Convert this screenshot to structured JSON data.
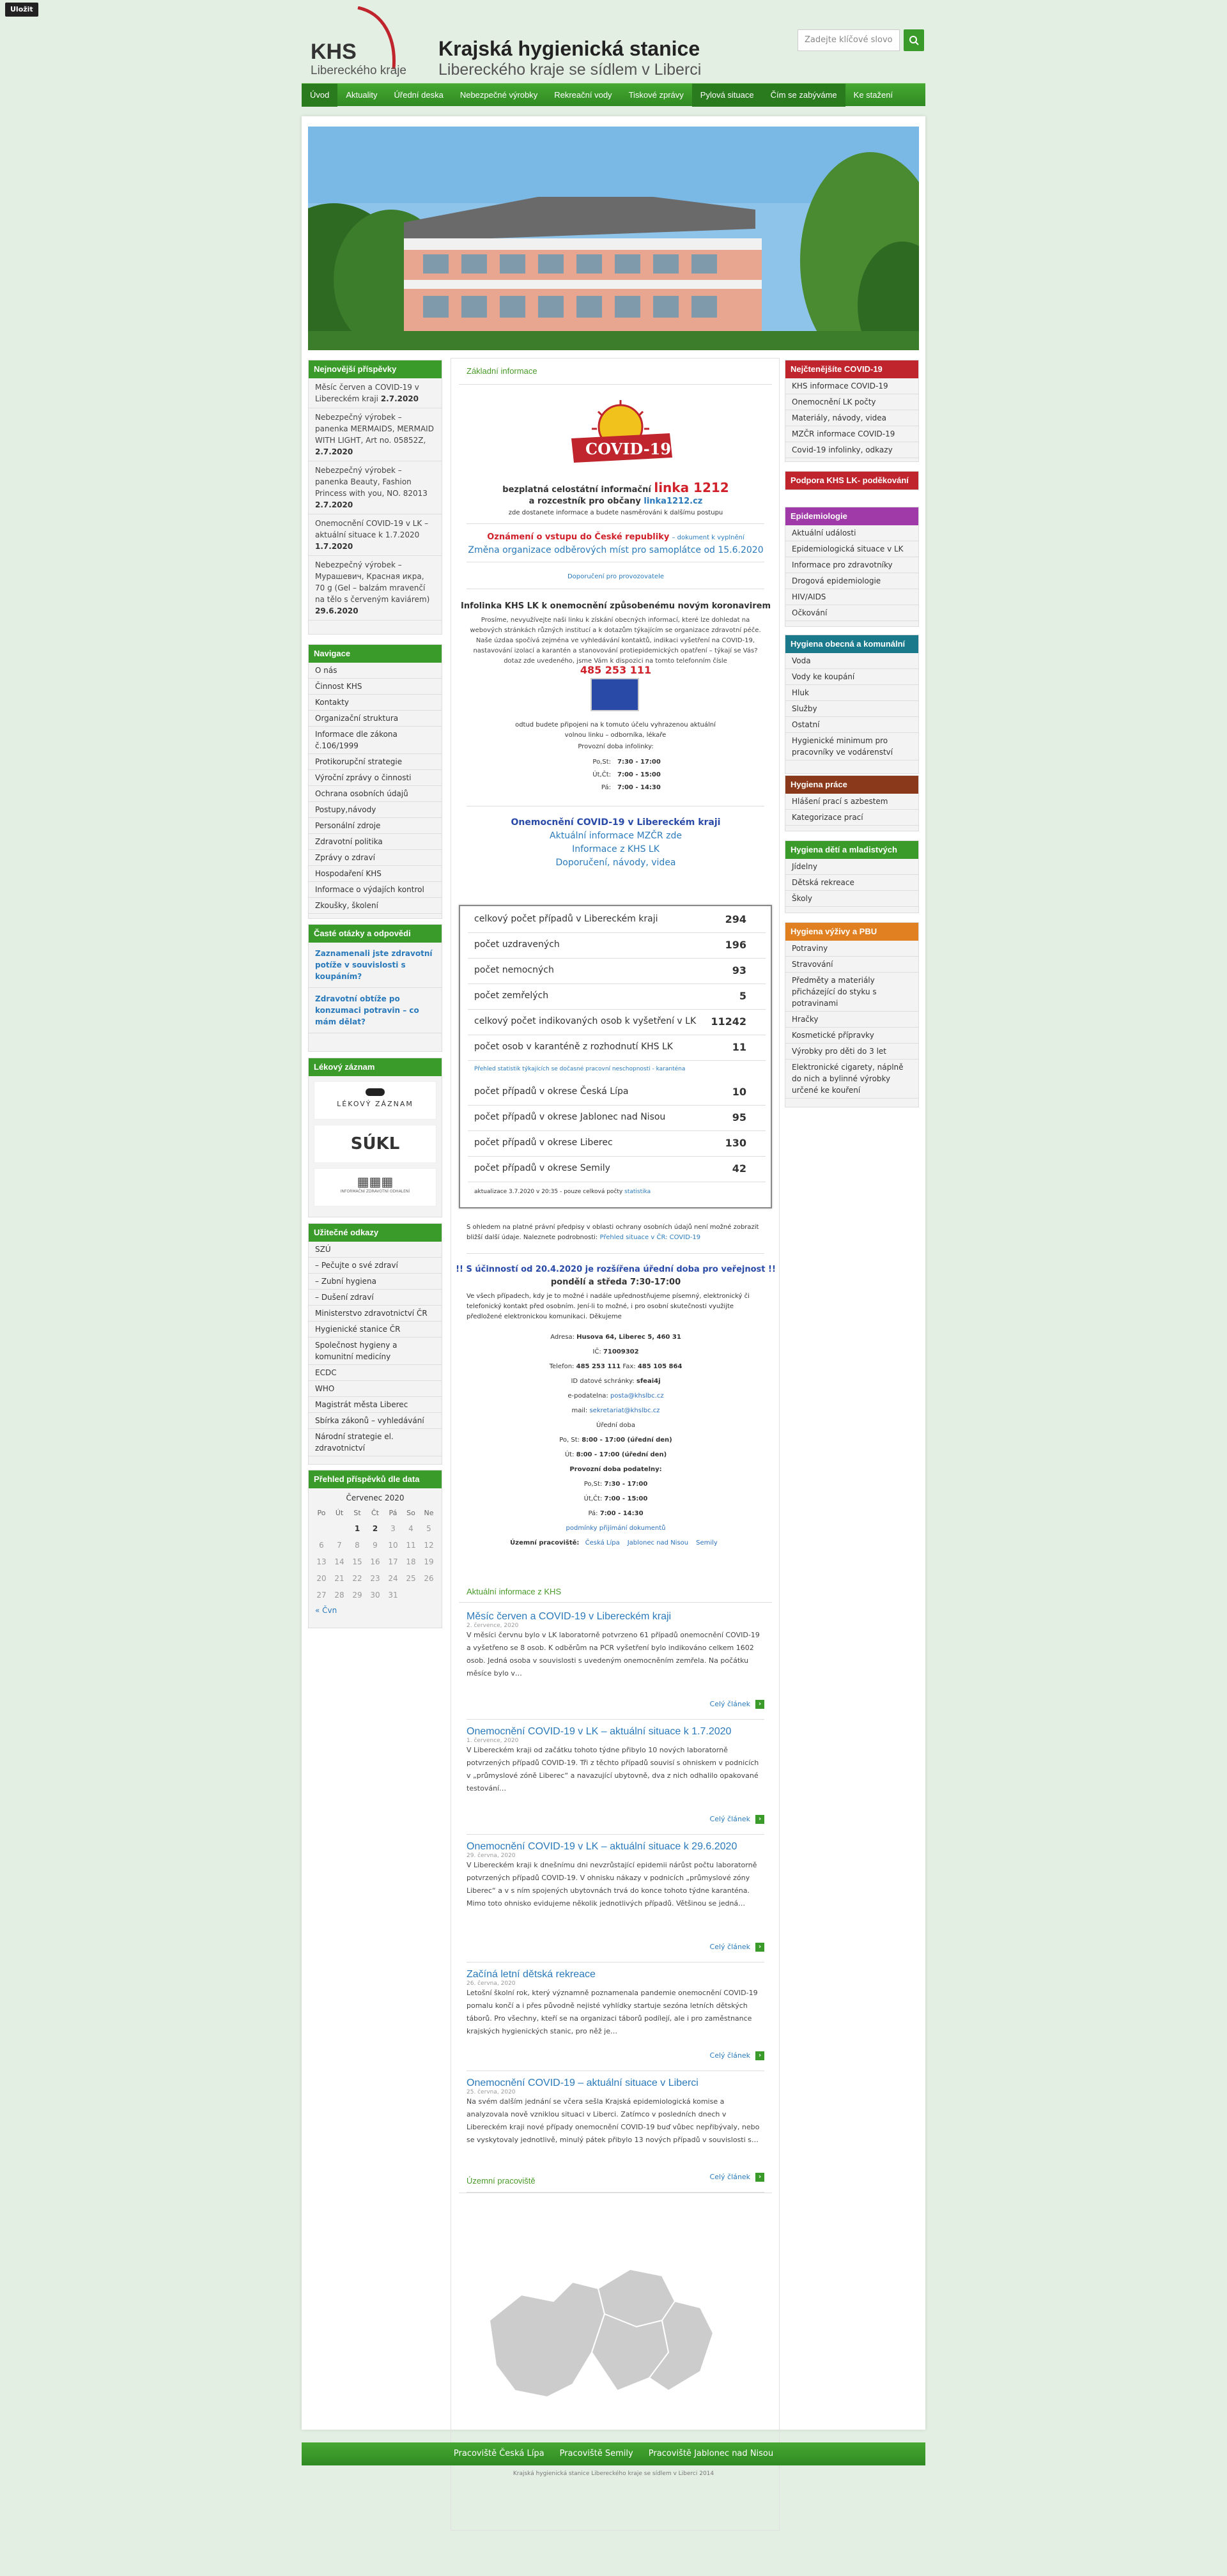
{
  "tag": "Uložit",
  "header": {
    "logo_big": "KHS",
    "logo_sub": "Libereckého kraje",
    "title": "Krajská hygienická stanice",
    "subtitle": "Libereckého kraje se sídlem v Liberci",
    "search_placeholder": "Zadejte klíčové slovo"
  },
  "nav": [
    "Úvod",
    "Aktuality",
    "Úřední deska",
    "Nebezpečné výrobky",
    "Rekreační vody",
    "Tiskové zprávy",
    "Pylová situace",
    "Čím se zabýváme",
    "Ke stažení"
  ],
  "left": {
    "latest_title": "Nejnovější příspěvky",
    "latest": [
      {
        "t": "Měsíc červen a COVID-19 v Libereckém kraji",
        "d": "2.7.2020"
      },
      {
        "t": "Nebezpečný výrobek – panenka MERMAIDS, MERMAID WITH LIGHT, Art no. 05852Z,",
        "d": "2.7.2020"
      },
      {
        "t": "Nebezpečný výrobek – panenka Beauty, Fashion Princess with you, NO. 82013",
        "d": "2.7.2020"
      },
      {
        "t": "Onemocnění COVID-19 v LK – aktuální situace k 1.7.2020",
        "d": "1.7.2020"
      },
      {
        "t": "Nebezpečný výrobek – Мурашевич, Красная икра, 70 g (Gel – balzám mravenčí na tělo s červeným kaviárem)",
        "d": "29.6.2020"
      }
    ],
    "nav_title": "Navigace",
    "nav_items": [
      "O nás",
      "Činnost KHS",
      "Kontakty",
      "Organizační struktura",
      "Informace dle zákona č.106/1999",
      "Protikorupční strategie",
      "Výroční zprávy o činnosti",
      "Ochrana osobních údajů",
      "Postupy,návody",
      "Personální zdroje",
      "Zdravotní politika",
      "Zprávy o zdraví",
      "Hospodaření KHS",
      "Informace o výdajích kontrol",
      "Zkoušky, školení"
    ],
    "faq_title": "Časté otázky a odpovědi",
    "faq": [
      "Zaznamenali jste zdravotní potíže v souvislosti s koupáním?",
      "Zdravotní obtíže po konzumaci potravin – co mám dělat?"
    ],
    "drug_title": "Lékový záznam",
    "drug_logos": [
      "LÉKOVÝ ZÁZNAM",
      "SÚKL",
      "INFORMAČNÍ ZDRAVOTNÍ ODHALENÍ"
    ],
    "links_title": "Užitečné odkazy",
    "links": [
      "SZÚ",
      "– Pečujte o své zdraví",
      "– Zubní hygiena",
      "– Dušení zdraví",
      "Ministerstvo zdravotnictví ČR",
      "Hygienické stanice ČR",
      "Společnost hygieny a komunitní medicíny",
      "ECDC",
      "WHO",
      "Magistrát města Liberec",
      "Sbírka zákonů – vyhledávání",
      "Národní strategie el. zdravotnictví"
    ],
    "cal_title": "Přehled příspěvků dle data",
    "cal_month": "Červenec 2020",
    "cal_days": [
      "Po",
      "Út",
      "St",
      "Čt",
      "Pá",
      "So",
      "Ne"
    ],
    "cal_rows": [
      [
        "",
        "",
        "1",
        "2",
        "3",
        "4",
        "5"
      ],
      [
        "6",
        "7",
        "8",
        "9",
        "10",
        "11",
        "12"
      ],
      [
        "13",
        "14",
        "15",
        "16",
        "17",
        "18",
        "19"
      ],
      [
        "20",
        "21",
        "22",
        "23",
        "24",
        "25",
        "26"
      ],
      [
        "27",
        "28",
        "29",
        "30",
        "31",
        "",
        ""
      ]
    ],
    "cal_prev": "« Čvn"
  },
  "right": {
    "covid_title": "Nejčtenějšíte COVID-19",
    "covid": [
      "KHS informace COVID-19",
      "Onemocnění LK počty",
      "Materiály, návody, videa",
      "MZČR informace COVID-19",
      "Covid-19 infolinky, odkazy"
    ],
    "support": "Podpora KHS LK- poděkování",
    "epi_title": "Epidemiologie",
    "epi": [
      "Aktuální události",
      "Epidemiologická situace v LK",
      "Informace pro zdravotníky",
      "Drogová epidemiologie",
      "HIV/AIDS",
      "Očkování"
    ],
    "hyg_title": "Hygiena obecná a komunální",
    "hyg": [
      "Voda",
      "Vody ke koupání",
      "Hluk",
      "Služby",
      "Ostatní",
      "Hygienické minimum pro pracovníky ve vodárenství"
    ],
    "work_title": "Hygiena práce",
    "work": [
      "Hlášení prací s azbestem",
      "Kategorizace prací"
    ],
    "kids_title": "Hygiena dětí a mladistvých",
    "kids": [
      "Jídelny",
      "Dětská rekreace",
      "Školy"
    ],
    "food_title": "Hygiena výživy a PBU",
    "food": [
      "Potraviny",
      "Stravování",
      "Předměty a materiály přicházející do styku s potravinami",
      "Hračky",
      "Kosmetické přípravky",
      "Výrobky pro děti do 3 let",
      "Elektronické cigarety, náplně do nich a bylinné výrobky určené ke kouření"
    ]
  },
  "main": {
    "basic_title": "Základní informace",
    "covid_logo": "COVID-19",
    "hotline_a": "bezplatná celostátní informační",
    "hotline_num": "linka 1212",
    "hotline_b": "a rozcestník pro občany",
    "hotline_link": "linka1212.cz",
    "hotline_c": "zde dostanete informace a budete nasměrováni k dalšímu postupu",
    "notice_red": "Oznámení o vstupu do České republiky",
    "notice_link": "– dokument k vyplnění",
    "notice_change": "Změna organizace odběrových míst pro samoplátce od 15.6.2020",
    "notice_small": "Doporučení pro provozovatele",
    "info_title": "Infolinka KHS LK k onemocnění způsobenému novým koronavirem",
    "info_text": "Prosíme, nevyužívejte naši linku k získání obecných informací, které lze dohledat na webových stránkách různých institucí a k dotazům týkajícím se organizace zdravotní péče. Naše úzdaa spočívá zejména ve vyhledávání kontaktů, indikaci vyšetření na COVID-19, nastavování izolací a karantén a stanovování protiepidemických opatření – týkají se Vás? dotaz zde uvedeného, jsme Vám k dispozici na tomto telefonním čísle",
    "info_phone": "485 253 111",
    "info_after": "odtud budete připojeni na k tomuto účelu vyhrazenou aktuální volnou linku – odborníka, lékaře",
    "hours_title": "Provozní doba infolinky:",
    "hours": [
      {
        "d": "Po,St:",
        "h": "7:30 - 17:00"
      },
      {
        "d": "Út,Čt:",
        "h": "7:00 - 15:00"
      },
      {
        "d": "Pá:",
        "h": "7:00 - 14:30"
      }
    ],
    "links_block": [
      "Onemocnění COVID-19 v Libereckém kraji",
      "Aktuální informace MZČR zde",
      "Informace z KHS LK",
      "Doporučení, návody, videa"
    ],
    "stats": [
      {
        "l": "celkový počet případů v Libereckém kraji",
        "v": "294"
      },
      {
        "l": "počet uzdravených",
        "v": "196"
      },
      {
        "l": "počet nemocných",
        "v": "93"
      },
      {
        "l": "počet zemřelých",
        "v": "5"
      },
      {
        "l": "celkový počet indikovaných osob k vyšetření v LK",
        "v": "11242"
      },
      {
        "l": "počet osob v karanténě z rozhodnutí KHS LK",
        "v": "11"
      }
    ],
    "stats_note": "Přehled statistik týkajících se dočasné pracovní neschopnosti - karanténa",
    "stats2": [
      {
        "l": "počet případů v okrese Česká Lípa",
        "v": "10"
      },
      {
        "l": "počet případů v okrese Jablonec nad Nisou",
        "v": "95"
      },
      {
        "l": "počet případů v okrese Liberec",
        "v": "130"
      },
      {
        "l": "počet případů v okrese Semily",
        "v": "42"
      }
    ],
    "stats_updated": "aktualizace 3.7.2020 v 20:35 - pouze celková počty",
    "stats_link": "statistika",
    "legal": "S ohledem na platné právní předpisy v oblasti ochrany osobních údajů není možné zobrazit bližší další údaje. Naleznete podrobnosti:",
    "legal_link": "Přehled situace v ČR: COVID-19",
    "office_title": "!! S účinností od 20.4.2020 je rozšířena úřední doba pro veřejnost !!",
    "office_sub": "pondělí a středa 7:30-17:00",
    "office_text": "Ve všech případech, kdy je to možné i nadále upřednostňujeme písemný, elektronický či telefonický kontakt před osobním. Jení-li to možné, i pro osobní skutečnosti využijte předložené elektronickou komunikaci. Děkujeme",
    "addr_l": "Adresa:",
    "addr": "Husova 64, Liberec 5, 460 31",
    "ic_l": "IČ:",
    "ic": "71009302",
    "tel_l": "Telefon:",
    "tel": "485 253 111",
    "fax_l": "Fax:",
    "fax": "485 105 864",
    "ds_l": "ID datové schránky:",
    "ds": "sfeai4j",
    "epod_l": "e-podatelna:",
    "epod": "posta@khslbc.cz",
    "mail_l": "mail:",
    "mail": "sekretariat@khslbc.cz",
    "uredni": "Úřední doba",
    "uh": [
      {
        "d": "Po, St:",
        "h": "8:00 - 17:00 (úřední den)"
      },
      {
        "d": "Út:",
        "h": "8:00 - 17:00 (úřední den)"
      }
    ],
    "prov": "Provozní doba podatelny:",
    "ph": [
      {
        "d": "Po,St:",
        "h": "7:30 - 17:00"
      },
      {
        "d": "Út,Čt:",
        "h": "7:00 - 15:00"
      },
      {
        "d": "Pá:",
        "h": "7:00 - 14:30"
      }
    ],
    "cond": "podmínky přijímání dokumentů",
    "territory_l": "Územní pracoviště:",
    "territories": [
      "Česká Lípa",
      "Jablonec nad Nisou",
      "Semily"
    ],
    "news_title": "Aktuální informace z KHS",
    "news": [
      {
        "t": "Měsíc červen a COVID-19 v Libereckém kraji",
        "d": "2. července, 2020",
        "x": "V měsíci červnu bylo v LK laboratorně potvrzeno 61 případů onemocnění COVID-19 a vyšetřeno se 8 osob. K odběrům na PCR vyšetření bylo indikováno celkem 1602 osob. Jedná osoba v souvislosti s uvedeným onemocněním zemřela. Na počátku měsíce bylo v…"
      },
      {
        "t": "Onemocnění COVID-19 v LK – aktuální situace k 1.7.2020",
        "d": "1. července, 2020",
        "x": "V Libereckém kraji od začátku tohoto týdne přibylo 10 nových laboratorně potvrzených případů COVID-19. Tři z těchto případů souvisí s ohniskem v podnicích v „průmyslové zóně Liberec“ a navazující ubytovně, dva z nich odhalilo opakované testování…"
      },
      {
        "t": "Onemocnění COVID-19 v LK – aktuální situace k 29.6.2020",
        "d": "29. června, 2020",
        "x": "V Libereckém kraji k dnešnímu dni nevzrůstající epidemii nárůst počtu laboratorně potvrzených případů COVID-19. V ohnisku nákazy v podnicích „průmyslové zóny Liberec“ a v s ním spojených ubytovnách trvá do konce tohoto týdne karanténa. Mimo toto ohnisko evidujeme několik jednotlivých případů. Většinou se jedná…"
      },
      {
        "t": "Začíná letní dětská rekreace",
        "d": "26. června, 2020",
        "x": "Letošní školní rok, který významně poznamenala pandemie onemocnění COVID-19 pomalu končí a i přes původně nejisté vyhlídky startuje sezóna letních dětských táborů. Pro všechny, kteří se na organizaci táborů podílejí, ale i pro zaměstnance krajských hygienických stanic, pro něž je…"
      },
      {
        "t": "Onemocnění COVID-19 – aktuální situace v Liberci",
        "d": "25. června, 2020",
        "x": "Na svém dalším jednání se včera sešla Krajská epidemiologická komise a analyzovala nově vzniklou situaci v Liberci. Zatímco v posledních dnech v Libereckém kraji nové případy onemocnění COVID-19 buď vůbec nepřibývaly, nebo se vyskytovaly jednotlivě, minulý pátek přibylo 13 nových případů v souvislosti s…"
      }
    ],
    "more": "Celý článek",
    "territory_title": "Územní pracoviště"
  },
  "footer": {
    "links": [
      "Pracoviště Česká Lípa",
      "Pracoviště Semily",
      "Pracoviště Jablonec nad Nisou"
    ],
    "copy": "Krajská hygienická stanice Libereckého kraje se sídlem v Liberci 2014"
  }
}
